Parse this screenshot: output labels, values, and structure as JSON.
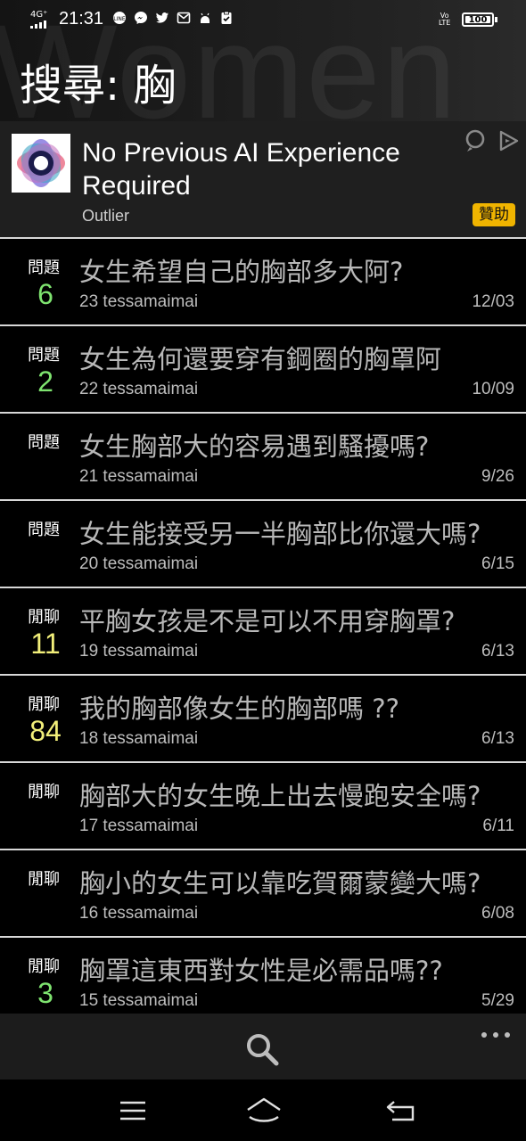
{
  "status_bar": {
    "network": "4G⁺",
    "time": "21:31",
    "notification_icons": [
      "line-icon",
      "messenger-icon",
      "twitter-icon",
      "mail-icon",
      "android-icon",
      "clipboard-check-icon"
    ],
    "volte": "Vo\nLTE",
    "battery": "100"
  },
  "header": {
    "watermark": "Women",
    "title": "搜尋: 胸"
  },
  "ad": {
    "title": "No Previous AI Experience Required",
    "source": "Outlier",
    "badge": "贊助"
  },
  "colors": {
    "count_green": "#7ee36f",
    "count_yellow": "#f2ef7a",
    "badge": "#f0b400"
  },
  "posts": [
    {
      "type": "問題",
      "count": "6",
      "count_color": "green",
      "title": "女生希望自己的胸部多大阿?",
      "meta": "23  tessamaimai",
      "date": "12/03"
    },
    {
      "type": "問題",
      "count": "2",
      "count_color": "green",
      "title": "女生為何還要穿有鋼圈的胸罩阿",
      "meta": "22  tessamaimai",
      "date": "10/09"
    },
    {
      "type": "問題",
      "count": "",
      "count_color": "green",
      "title": "女生胸部大的容易遇到騷擾嗎?",
      "meta": "21  tessamaimai",
      "date": "9/26"
    },
    {
      "type": "問題",
      "count": "",
      "count_color": "green",
      "title": "女生能接受另一半胸部比你還大嗎?",
      "meta": "20  tessamaimai",
      "date": "6/15"
    },
    {
      "type": "閒聊",
      "count": "11",
      "count_color": "yellow",
      "title": "平胸女孩是不是可以不用穿胸罩?",
      "meta": "19  tessamaimai",
      "date": "6/13"
    },
    {
      "type": "閒聊",
      "count": "84",
      "count_color": "yellow",
      "title": "我的胸部像女生的胸部嗎 ??",
      "meta": "18  tessamaimai",
      "date": "6/13"
    },
    {
      "type": "閒聊",
      "count": "",
      "count_color": "yellow",
      "title": "胸部大的女生晚上出去慢跑安全嗎?",
      "meta": "17  tessamaimai",
      "date": "6/11"
    },
    {
      "type": "閒聊",
      "count": "",
      "count_color": "yellow",
      "title": "胸小的女生可以靠吃賀爾蒙變大嗎?",
      "meta": "16  tessamaimai",
      "date": "6/08"
    },
    {
      "type": "閒聊",
      "count": "3",
      "count_color": "green",
      "title": "胸罩這東西對女性是必需品嗎??",
      "meta": "15  tessamaimai",
      "date": "5/29"
    }
  ],
  "bottom_bar": {
    "search_icon": "search-icon",
    "more_icon": "more-dots-icon"
  },
  "nav_bar": {
    "icons": [
      "menu-icon",
      "home-icon",
      "back-icon"
    ]
  }
}
